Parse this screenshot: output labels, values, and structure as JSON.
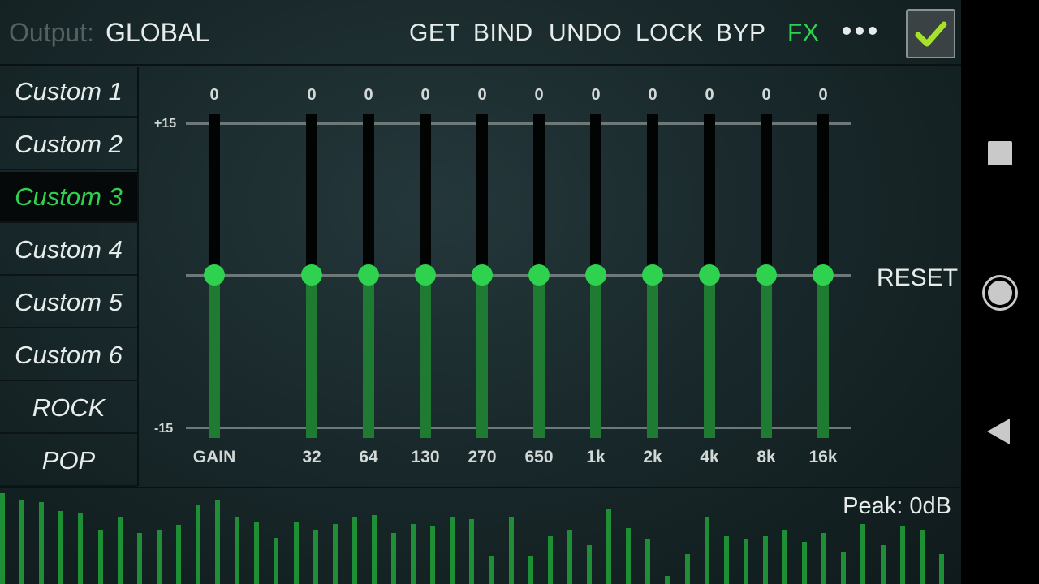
{
  "topbar": {
    "output_label": "Output:",
    "output_value": "GLOBAL",
    "buttons": {
      "get": "GET",
      "bind": "BIND",
      "undo": "UNDO",
      "lock": "LOCK",
      "byp": "BYP",
      "fx": "FX"
    },
    "accent_color": "#2ed24e",
    "more_icon": "more-horizontal-icon",
    "confirm_icon": "checkmark-icon"
  },
  "presets": [
    {
      "label": "Custom 1",
      "active": false
    },
    {
      "label": "Custom 2",
      "active": false
    },
    {
      "label": "Custom 3",
      "active": true
    },
    {
      "label": "Custom 4",
      "active": false
    },
    {
      "label": "Custom 5",
      "active": false
    },
    {
      "label": "Custom 6",
      "active": false
    },
    {
      "label": "ROCK",
      "active": false
    },
    {
      "label": "POP",
      "active": false
    }
  ],
  "eq": {
    "scale_max_label": "+15",
    "scale_min_label": "-15",
    "range_db": [
      -15,
      15
    ],
    "bands": [
      {
        "label": "GAIN",
        "value": "0"
      },
      {
        "label": "32",
        "value": "0"
      },
      {
        "label": "64",
        "value": "0"
      },
      {
        "label": "130",
        "value": "0"
      },
      {
        "label": "270",
        "value": "0"
      },
      {
        "label": "650",
        "value": "0"
      },
      {
        "label": "1k",
        "value": "0"
      },
      {
        "label": "2k",
        "value": "0"
      },
      {
        "label": "4k",
        "value": "0"
      },
      {
        "label": "8k",
        "value": "0"
      },
      {
        "label": "16k",
        "value": "0"
      }
    ],
    "reset_label": "RESET"
  },
  "spectrum": {
    "peak_label": "Peak: 0dB",
    "levels": [
      1.0,
      0.93,
      0.9,
      0.8,
      0.79,
      0.6,
      0.73,
      0.56,
      0.59,
      0.65,
      0.87,
      0.93,
      0.73,
      0.69,
      0.51,
      0.69,
      0.59,
      0.66,
      0.73,
      0.76,
      0.56,
      0.66,
      0.63,
      0.74,
      0.71,
      0.31,
      0.73,
      0.31,
      0.53,
      0.59,
      0.43,
      0.83,
      0.62,
      0.49,
      0.09,
      0.33,
      0.73,
      0.53,
      0.49,
      0.53,
      0.59,
      0.46,
      0.56,
      0.36,
      0.66,
      0.43,
      0.63,
      0.6,
      0.33
    ]
  },
  "navbar": {
    "recents_icon": "recents-square-icon",
    "home_icon": "home-circle-icon",
    "back_icon": "back-triangle-icon"
  }
}
